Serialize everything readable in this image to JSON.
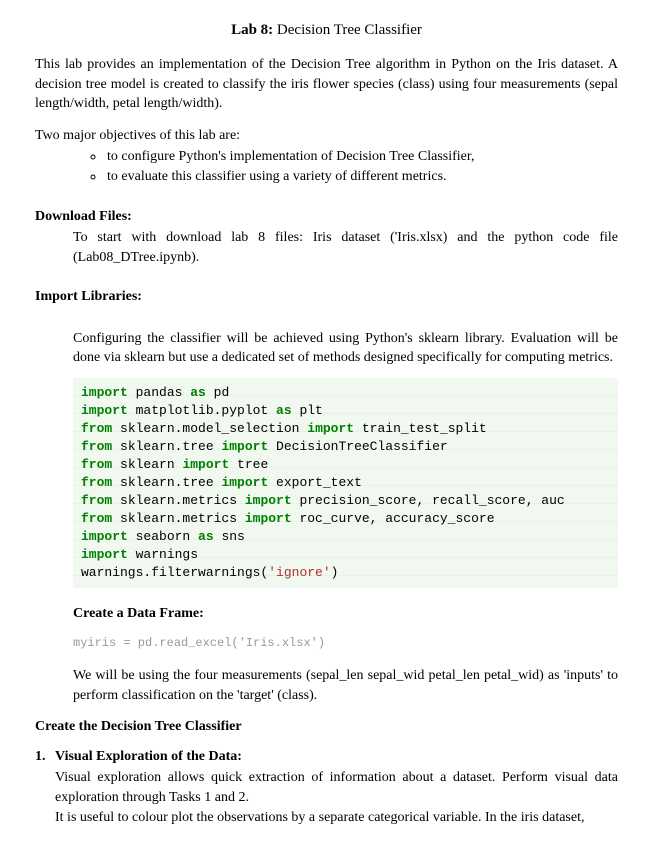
{
  "title": {
    "label": "Lab 8:",
    "name": "Decision Tree Classifier"
  },
  "intro": "This lab provides an implementation of the Decision Tree algorithm in Python on the Iris dataset. A decision tree model is created to classify the iris flower species (class) using four measurements (sepal length/width, petal length/width).",
  "objectives_intro": "Two major objectives of this lab are:",
  "objectives": [
    "to configure Python's implementation of Decision Tree Classifier,",
    "to evaluate this classifier using a variety of different metrics."
  ],
  "download": {
    "heading": "Download Files:",
    "text_line": "To start with download lab 8 files: Iris dataset ('Iris.xlsx) and the python code file",
    "text_line2": "(Lab08_DTree.ipynb)."
  },
  "import": {
    "heading": "Import Libraries:",
    "text": "Configuring the classifier will be achieved using Python's sklearn library. Evaluation will be done via sklearn but use a dedicated set of methods designed specifically for computing metrics."
  },
  "code": {
    "l1_kw1": "import",
    "l1_t1": " pandas ",
    "l1_kw2": "as",
    "l1_t2": " pd",
    "l2_kw1": "import",
    "l2_t1": " matplotlib.pyplot ",
    "l2_kw2": "as",
    "l2_t2": " plt",
    "l3_kw1": "from",
    "l3_t1": " sklearn.model_selection ",
    "l3_kw2": "import",
    "l3_t2": " train_test_split",
    "l4_kw1": "from",
    "l4_t1": " sklearn.tree ",
    "l4_kw2": "import",
    "l4_t2": " DecisionTreeClassifier",
    "l5_kw1": "from",
    "l5_t1": " sklearn ",
    "l5_kw2": "import",
    "l5_t2": " tree",
    "l6_kw1": "from",
    "l6_t1": " sklearn.tree ",
    "l6_kw2": "import",
    "l6_t2": " export_text",
    "l7_kw1": "from",
    "l7_t1": " sklearn.metrics ",
    "l7_kw2": "import",
    "l7_t2": " precision_score, recall_score, auc",
    "l8_kw1": "from",
    "l8_t1": " sklearn.metrics ",
    "l8_kw2": "import",
    "l8_t2": " roc_curve, accuracy_score",
    "l9_kw1": "import",
    "l9_t1": " seaborn ",
    "l9_kw2": "as",
    "l9_t2": " sns",
    "l10_kw1": "import",
    "l10_t1": " warnings",
    "l11_t1": "warnings.filterwarnings(",
    "l11_str": "'ignore'",
    "l11_t2": ")"
  },
  "create_df": {
    "heading": "Create a Data Frame:",
    "code": "myiris = pd.read_excel('Iris.xlsx')",
    "text": "We will be using the four measurements (sepal_len   sepal_wid   petal_len   petal_wid) as 'inputs' to perform classification on the 'target' (class)."
  },
  "create_classifier": {
    "heading": "Create the Decision Tree Classifier"
  },
  "visual": {
    "num": "1.",
    "title": "Visual Exploration of the Data:",
    "body1": "Visual exploration allows quick extraction of information about a dataset. Perform visual data exploration through Tasks 1 and 2.",
    "body2": "It is useful to colour plot the observations by a separate categorical variable. In the iris dataset,"
  }
}
